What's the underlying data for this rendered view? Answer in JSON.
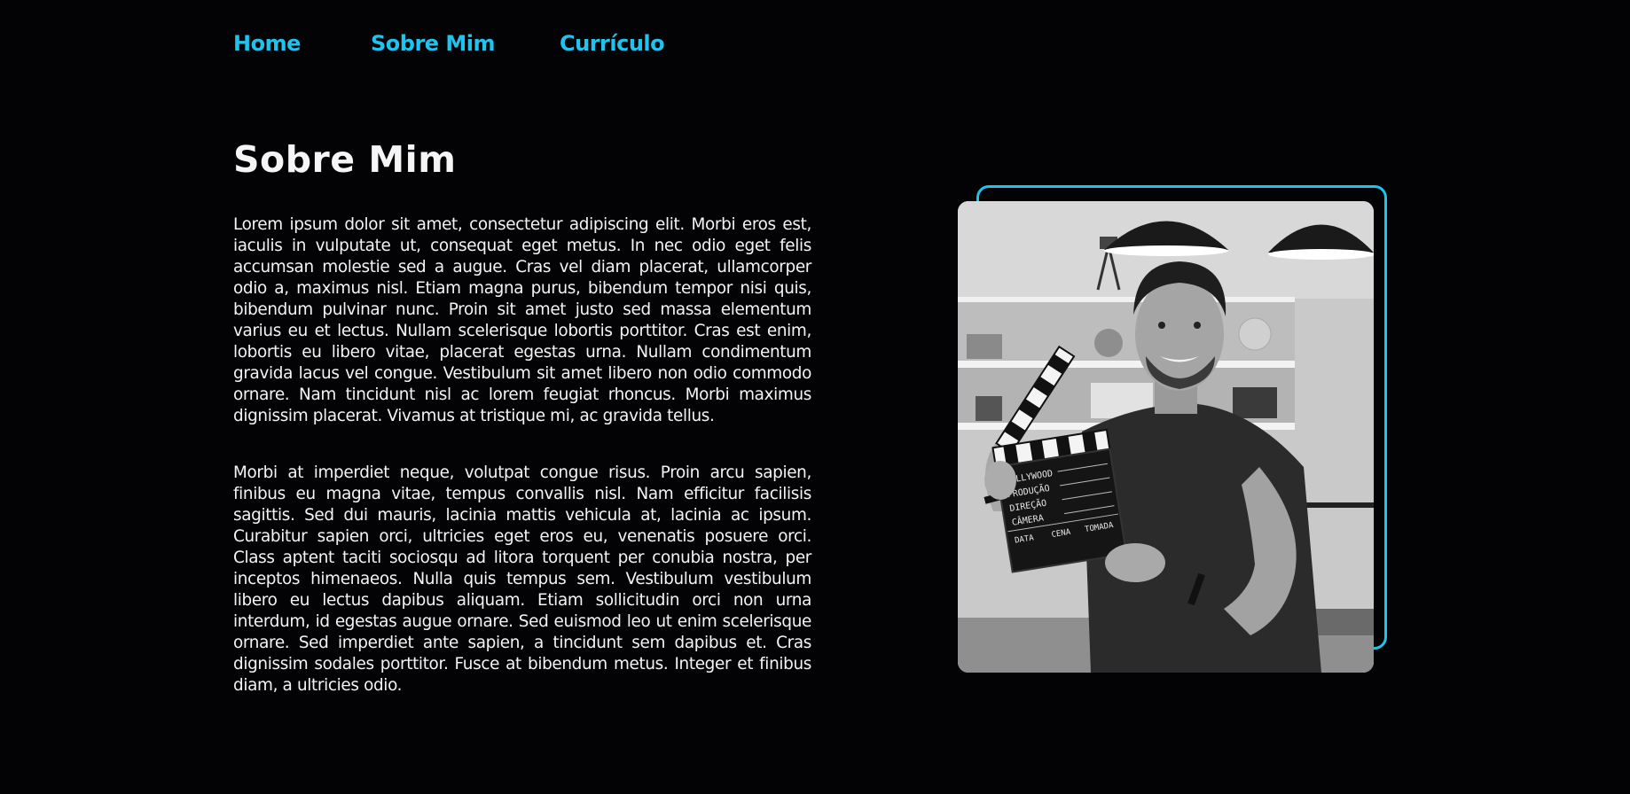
{
  "nav": {
    "items": [
      {
        "label": "Home"
      },
      {
        "label": "Sobre Mim"
      },
      {
        "label": "Currículo"
      }
    ]
  },
  "about": {
    "title": "Sobre Mim",
    "paragraphs": [
      "Lorem ipsum dolor sit amet, consectetur adipiscing elit. Morbi eros est, iaculis in vulputate ut, consequat eget metus. In nec odio eget felis accumsan molestie sed a augue. Cras vel diam placerat, ullamcorper odio a, maximus nisl. Etiam magna purus, bibendum tempor nisi quis, bibendum pulvinar nunc. Proin sit amet justo sed massa elementum varius eu et lectus. Nullam scelerisque lobortis porttitor. Cras est enim, lobortis eu libero vitae, placerat egestas urna. Nullam condimentum gravida lacus vel congue. Vestibulum sit amet libero non odio commodo ornare. Nam tincidunt nisl ac lorem feugiat rhoncus. Morbi maximus dignissim placerat. Vivamus at tristique mi, ac gravida tellus.",
      "Morbi at imperdiet neque, volutpat congue risus. Proin arcu sapien, finibus eu magna vitae, tempus convallis nisl. Nam efficitur facilisis sagittis. Sed dui mauris, lacinia mattis vehicula at, lacinia ac ipsum. Curabitur sapien orci, ultricies eget eros eu, venenatis posuere orci. Class aptent taciti sociosqu ad litora torquent per conubia nostra, per inceptos himenaeos. Nulla quis tempus sem. Vestibulum vestibulum libero eu lectus dapibus aliquam. Etiam sollicitudin orci non urna interdum, id egestas augue ornare. Sed euismod leo ut enim scelerisque ornare. Sed imperdiet ante sapien, a tincidunt sem dapibus et. Cras dignissim sodales porttitor. Fusce at bibendum metus. Integer et finibus diam, a ultricies odio."
    ]
  },
  "photo": {
    "clapper": {
      "line1": "HOLLYWOOD",
      "line2": "PRODUÇÃO",
      "line3": "DIREÇÃO",
      "line4": "CÂMERA",
      "line5a": "DATA",
      "line5b": "CENA",
      "line5c": "TOMADA"
    }
  },
  "colors": {
    "background": "#030305",
    "accent": "#1fc3eb",
    "text": "#f2f2f2"
  }
}
